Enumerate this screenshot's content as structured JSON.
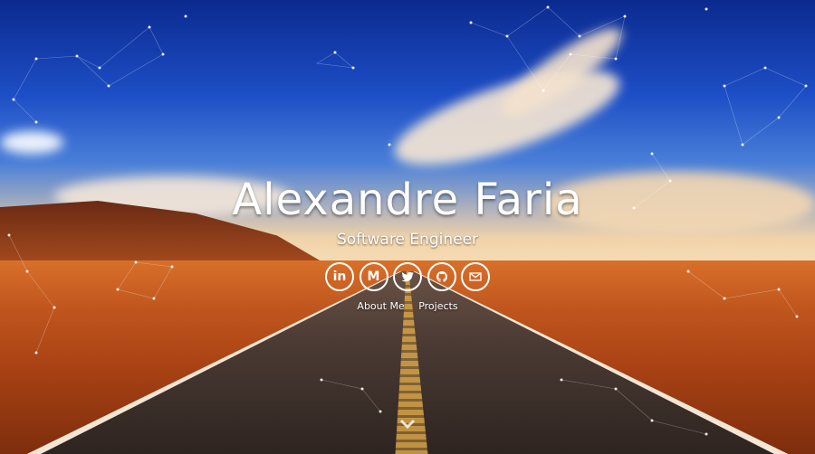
{
  "profile": {
    "name": "Alexandre Faria",
    "role": "Software Engineer"
  },
  "social": [
    {
      "icon": "linkedin-icon",
      "label": "in"
    },
    {
      "icon": "medium-icon",
      "label": "M"
    },
    {
      "icon": "twitter-icon",
      "label": ""
    },
    {
      "icon": "github-icon",
      "label": ""
    },
    {
      "icon": "email-icon",
      "label": ""
    }
  ],
  "nav": {
    "about": "About Me",
    "projects": "Projects"
  },
  "scroll": {
    "icon": "chevron-down-icon"
  },
  "colors": {
    "text": "#ffffff",
    "sky": "#1d4ec6",
    "desert": "#c0561e"
  }
}
